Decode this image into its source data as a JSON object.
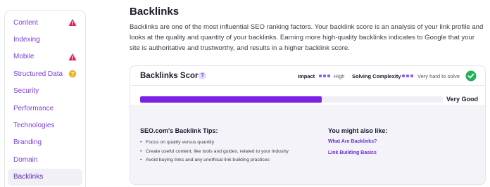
{
  "sidebar": {
    "items": [
      {
        "label": "Content",
        "status": "warning"
      },
      {
        "label": "Indexing",
        "status": ""
      },
      {
        "label": "Mobile",
        "status": "warning"
      },
      {
        "label": "Structured Data",
        "status": "info"
      },
      {
        "label": "Security",
        "status": ""
      },
      {
        "label": "Performance",
        "status": ""
      },
      {
        "label": "Technologies",
        "status": ""
      },
      {
        "label": "Branding",
        "status": ""
      },
      {
        "label": "Domain",
        "status": ""
      },
      {
        "label": "Backlinks",
        "status": "active"
      }
    ]
  },
  "section": {
    "title": "Backlinks",
    "description": "Backlinks are one of the most influential SEO ranking factors. Your backlink score is an analysis of your link profile and looks at the quality and quantity of your backlinks. Earning more high-quality backlinks indicates to Google that your site is authoritative and trustworthy, and results in a higher backlink score."
  },
  "card": {
    "title": "Backlinks Score",
    "help_icon": "?",
    "impact_label": "Impact",
    "impact_value": "High",
    "complexity_label": "Solving Complexity",
    "complexity_value": "Very hard to solve",
    "score_fraction": 0.6,
    "score_label": "Very Good",
    "tips_title": "SEO.com's Backlink Tips:",
    "tips": [
      "Focus on quality versus quantity",
      "Create useful content, like tools and guides, related to your industry",
      "Avoid buying links and any unethical link building practices"
    ],
    "also_title": "You might also like:",
    "links": [
      "What Are Backlinks?",
      "Link Building Basics"
    ]
  },
  "colors": {
    "accent": "#7c22e6",
    "warning": "#e0244f",
    "info": "#f2b01e",
    "success": "#21b15a"
  }
}
